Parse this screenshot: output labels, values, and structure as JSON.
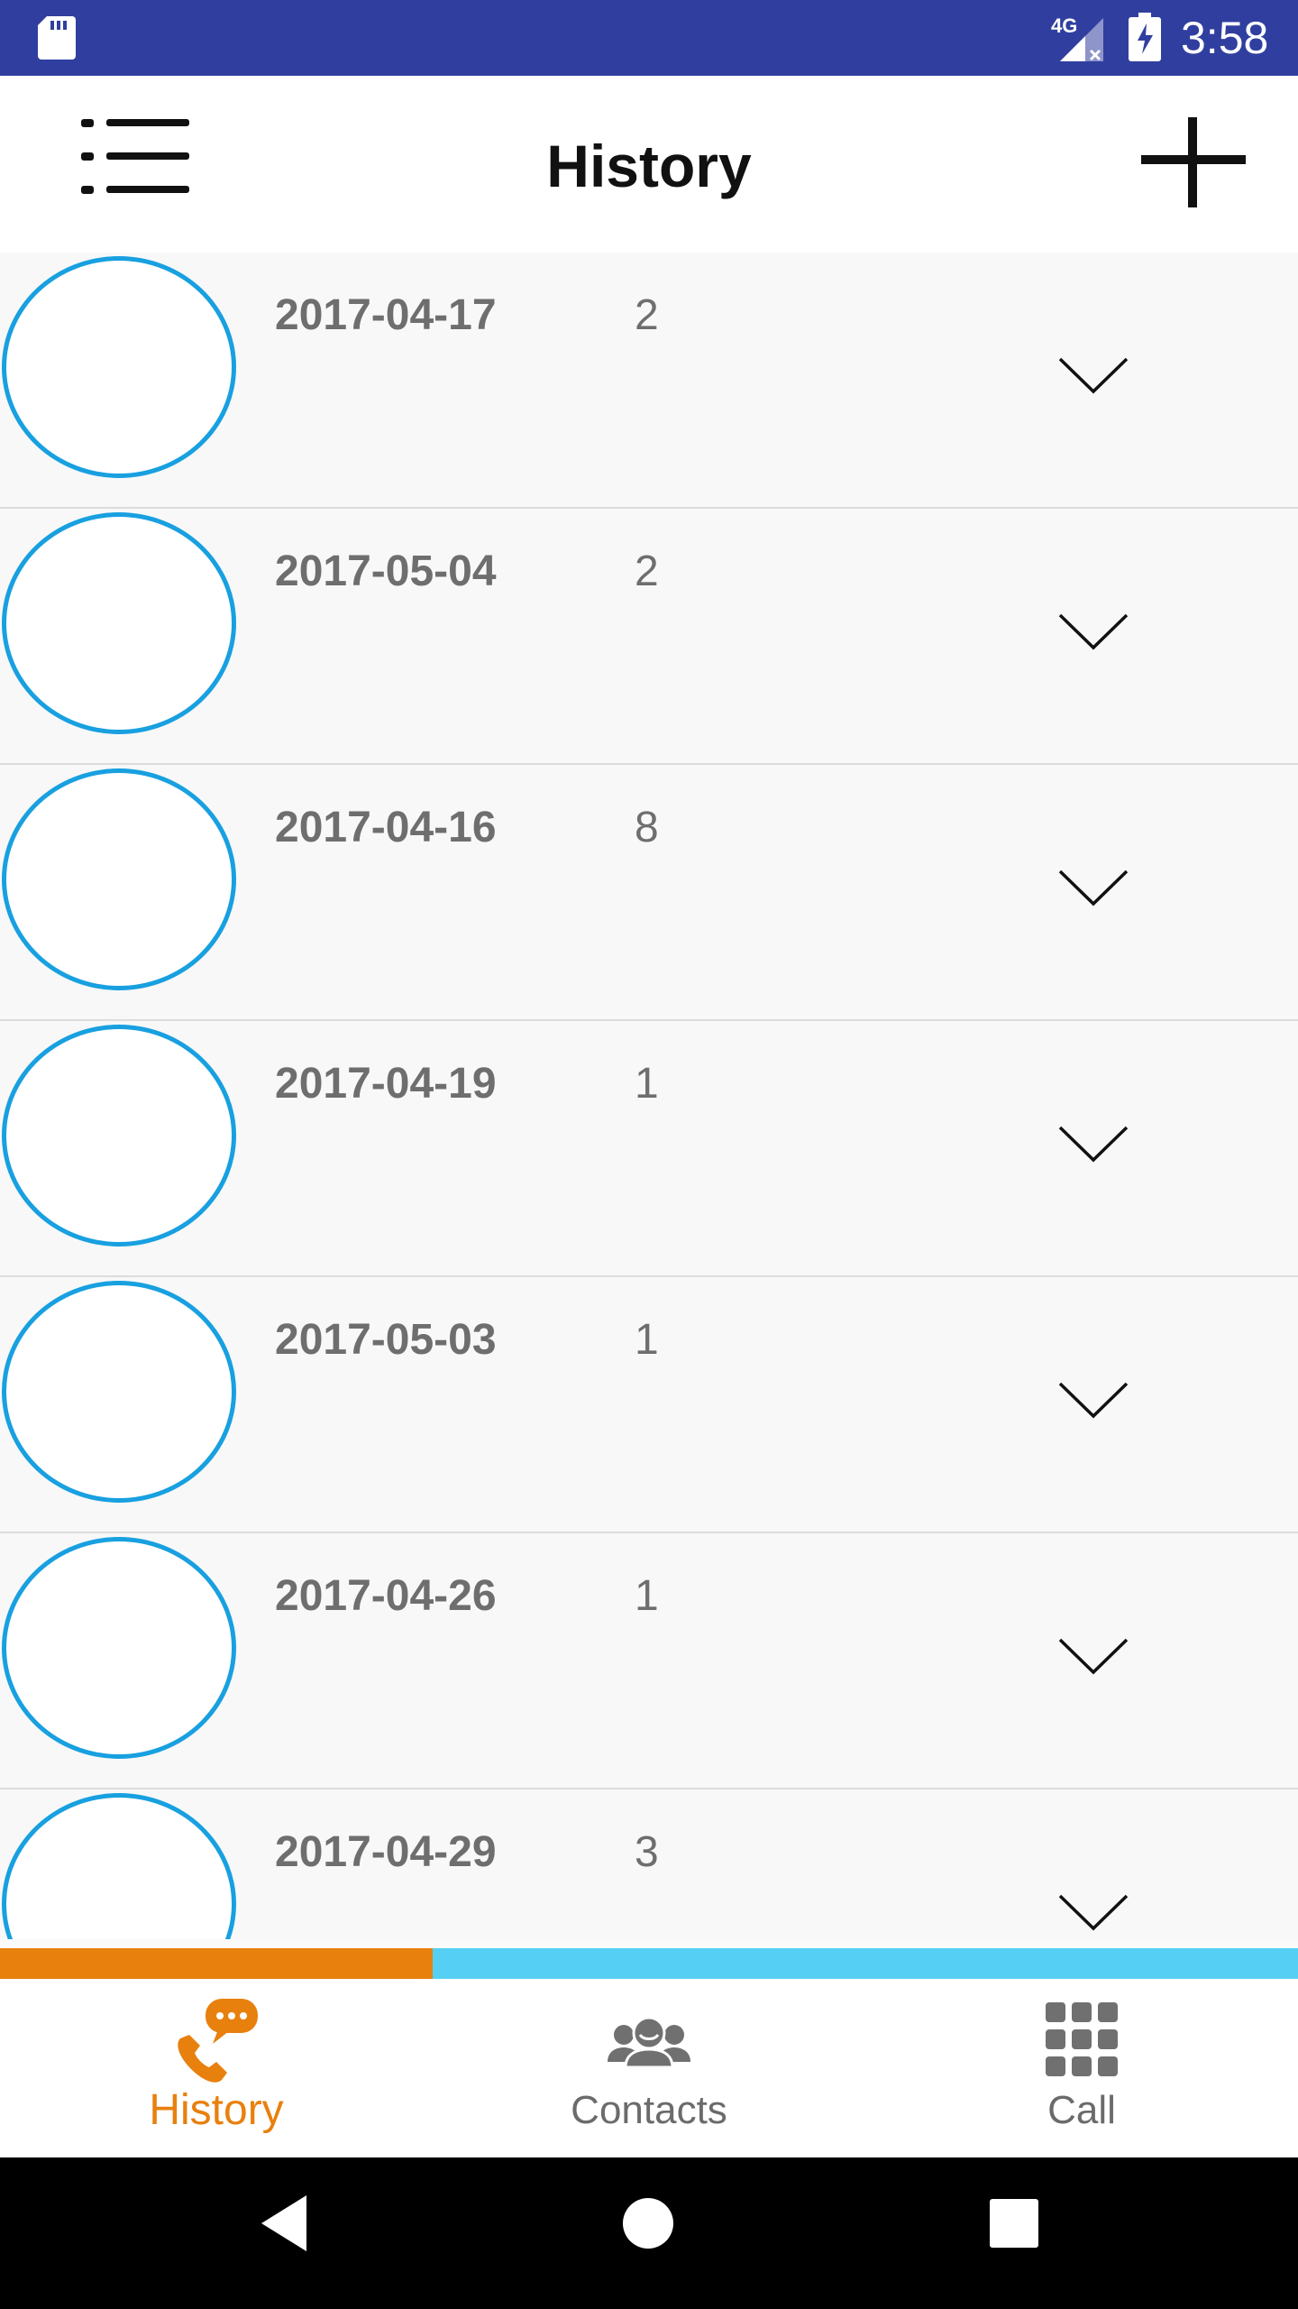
{
  "status_bar": {
    "time": "3:58",
    "network_label": "4G",
    "bg_color": "#303f9f"
  },
  "app_bar": {
    "title": "History",
    "menu_icon": "list-menu-icon",
    "add_icon": "plus-icon"
  },
  "history": [
    {
      "date": "2017-04-17",
      "count": "2"
    },
    {
      "date": "2017-05-04",
      "count": "2"
    },
    {
      "date": "2017-04-16",
      "count": "8"
    },
    {
      "date": "2017-04-19",
      "count": "1"
    },
    {
      "date": "2017-05-03",
      "count": "1"
    },
    {
      "date": "2017-04-26",
      "count": "1"
    },
    {
      "date": "2017-04-29",
      "count": "3"
    }
  ],
  "tabs": [
    {
      "label": "History",
      "icon": "phone-chat-icon",
      "active": true
    },
    {
      "label": "Contacts",
      "icon": "group-icon",
      "active": false
    },
    {
      "label": "Call",
      "icon": "dialpad-icon",
      "active": false
    }
  ],
  "colors": {
    "accent": "#e8800e",
    "indicator": "#55d0f4",
    "avatar_ring": "#18a0e0",
    "text_gray": "#6e6e6e"
  }
}
